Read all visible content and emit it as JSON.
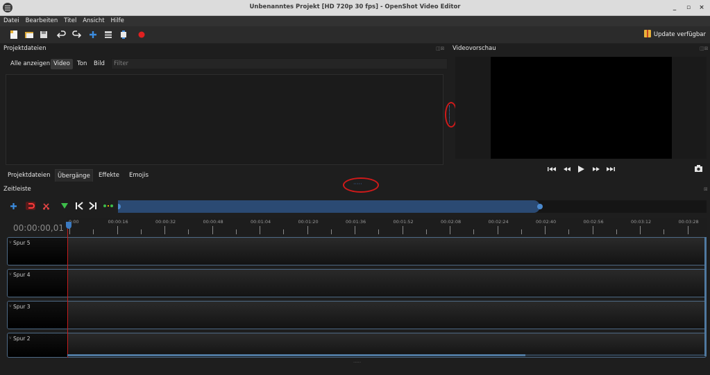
{
  "window": {
    "title": "Unbenanntes Projekt [HD 720p 30 fps] - OpenShot Video Editor",
    "min_label": "_",
    "max_label": "▫",
    "close_label": "×"
  },
  "menu": [
    "Datei",
    "Bearbeiten",
    "Titel",
    "Ansicht",
    "Hilfe"
  ],
  "toolbar": {
    "icons": [
      "new-project-icon",
      "open-project-icon",
      "save-project-icon",
      "undo-icon",
      "redo-icon",
      "import-files-icon",
      "profile-icon",
      "fullscreen-icon",
      "export-video-icon"
    ],
    "update_label": "Update verfügbar"
  },
  "project_files": {
    "title": "Projektdateien",
    "filter_tabs": [
      "Alle anzeigen",
      "Video",
      "Ton",
      "Bild"
    ],
    "active_filter": "Video",
    "filter_placeholder": "Filter",
    "dock_controls": "◫⊠"
  },
  "bottom_tabs": {
    "items": [
      "Projektdateien",
      "Übergänge",
      "Effekte",
      "Emojis"
    ],
    "active": "Übergänge"
  },
  "preview": {
    "title": "Videovorschau",
    "controls": [
      "jump-start-icon",
      "rewind-icon",
      "play-icon",
      "fast-forward-icon",
      "jump-end-icon"
    ],
    "snapshot_icon": "camera-icon",
    "dock_controls": "◫⊠"
  },
  "timeline": {
    "title": "Zeitleiste",
    "timecode": "00:00:00,01",
    "tick_labels": [
      "0:00",
      "00:00:16",
      "00:00:32",
      "00:00:48",
      "00:01:04",
      "00:01:20",
      "00:01:36",
      "00:01:52",
      "00:02:08",
      "00:02:24",
      "00:02:40",
      "00:02:56",
      "00:03:12",
      "00:03:28"
    ],
    "tools": [
      "add-track-icon",
      "snap-icon",
      "razor-icon",
      "add-marker-icon",
      "previous-marker-icon",
      "next-marker-icon",
      "center-playhead-icon"
    ],
    "tracks": [
      "Spur 5",
      "Spur 4",
      "Spur 3",
      "Spur 2"
    ],
    "dock_control": "⊠"
  },
  "colors": {
    "accent": "#3c7bc2",
    "playhead": "#c51d1d",
    "annotation": "#d11a1a",
    "background": "#1e1e1e"
  }
}
